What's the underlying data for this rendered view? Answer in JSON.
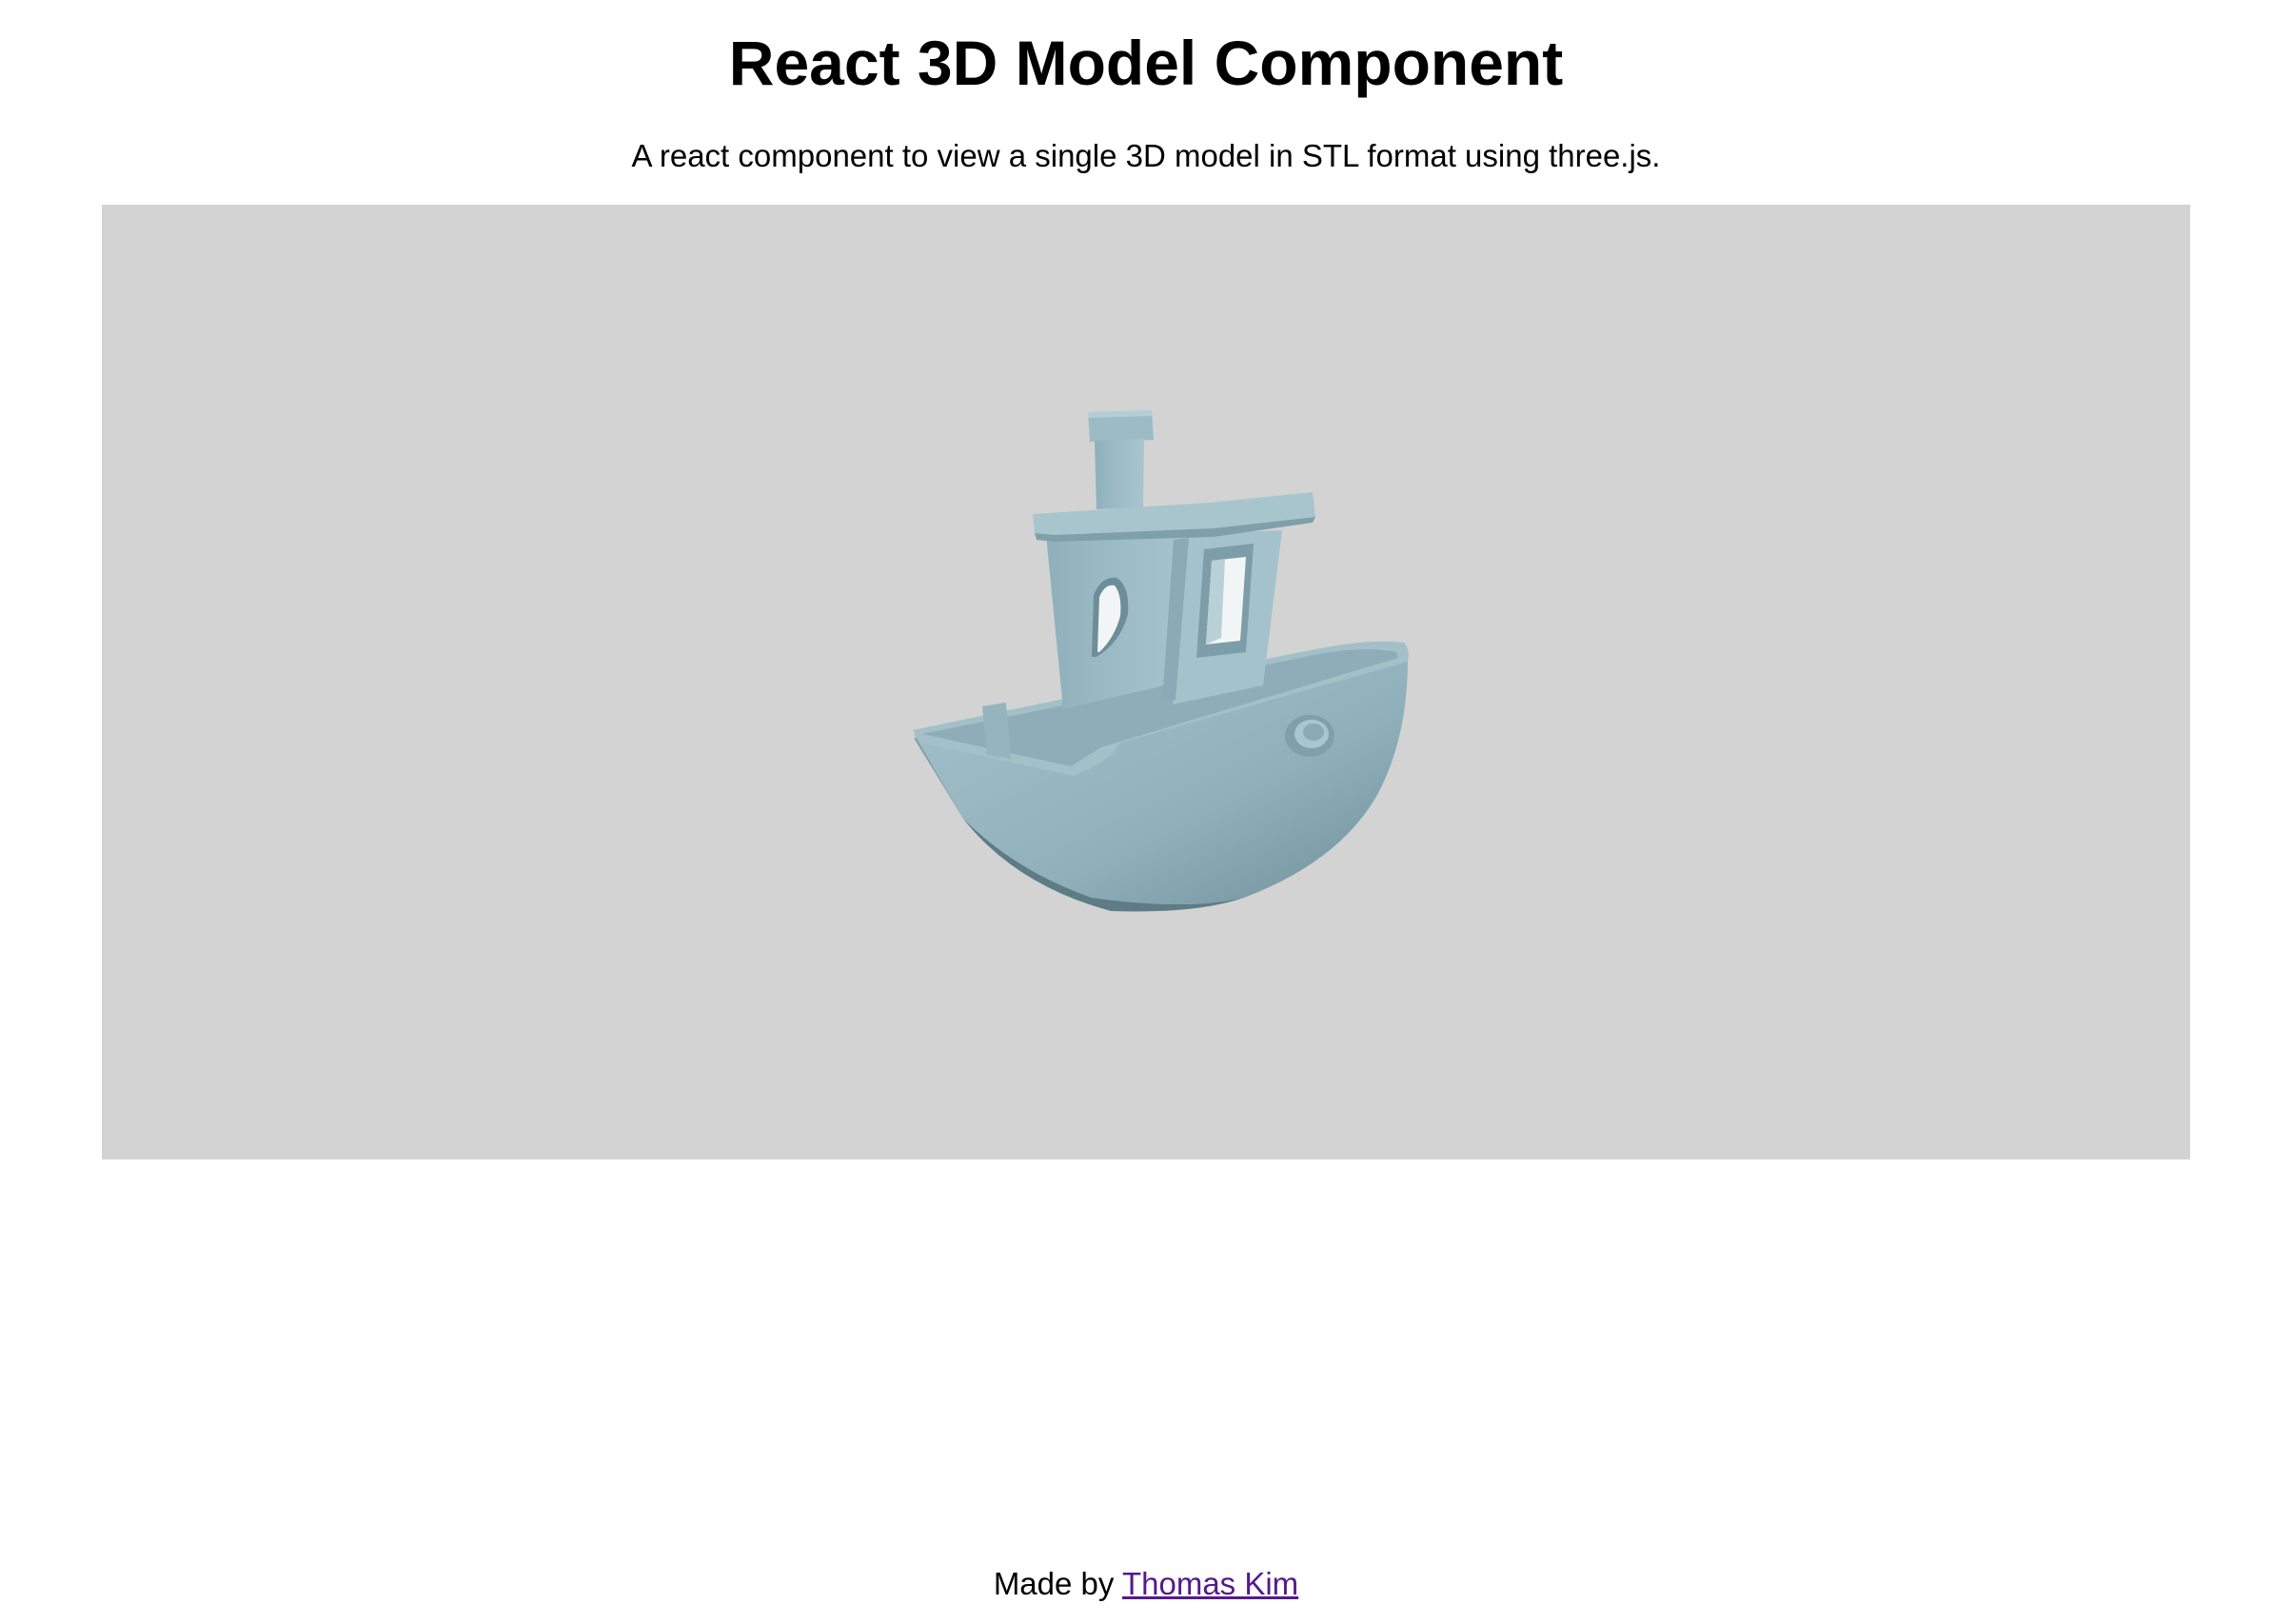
{
  "header": {
    "title": "React 3D Model Component",
    "subtitle": "A react component to view a single 3D model in STL format using three.js."
  },
  "viewer": {
    "background_color": "#d3d3d3",
    "model_color": "#9ab8c2",
    "model_icon": "boat-model-icon"
  },
  "footer": {
    "prefix": "Made by ",
    "author_link": "Thomas Kim"
  }
}
